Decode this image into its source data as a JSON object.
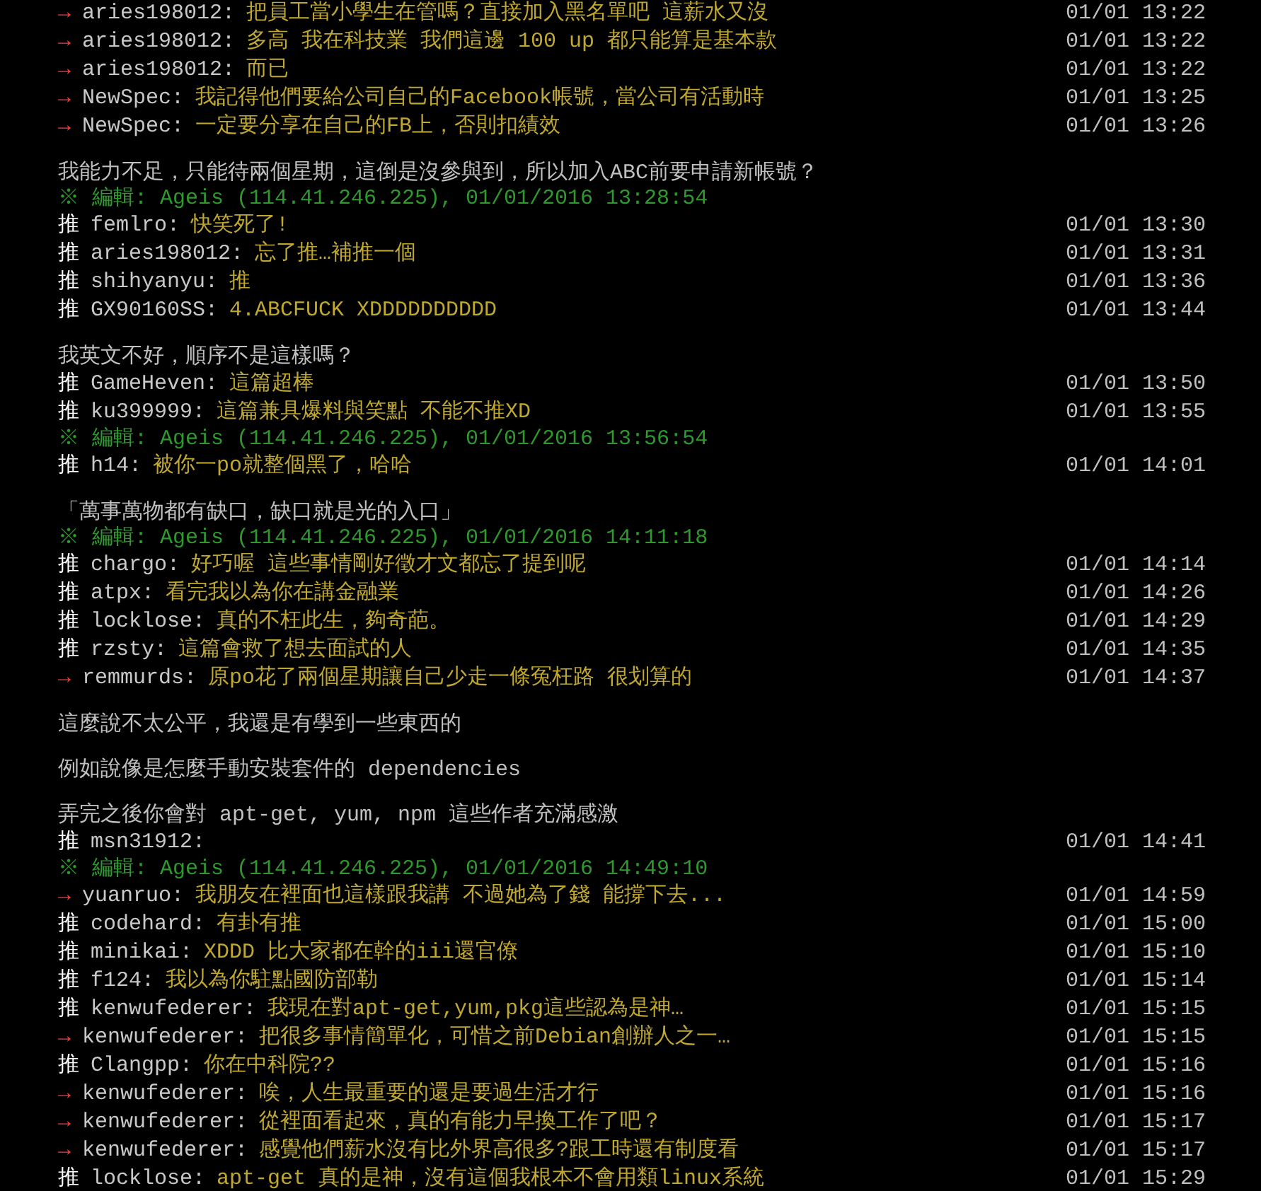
{
  "lines": [
    {
      "kind": "arrow",
      "tag": "→",
      "user": "aries198012:",
      "text": "把員工當小學生在管嗎？直接加入黑名單吧 這薪水又沒",
      "time": "01/01 13:22"
    },
    {
      "kind": "arrow",
      "tag": "→",
      "user": "aries198012:",
      "text": "多高 我在科技業 我們這邊 100 up 都只能算是基本款",
      "time": "01/01 13:22"
    },
    {
      "kind": "arrow",
      "tag": "→",
      "user": "aries198012:",
      "text": "而已",
      "time": "01/01 13:22"
    },
    {
      "kind": "arrow",
      "tag": "→",
      "user": "NewSpec:",
      "text": "我記得他們要給公司自己的Facebook帳號，當公司有活動時",
      "time": "01/01 13:25"
    },
    {
      "kind": "arrow",
      "tag": "→",
      "user": "NewSpec:",
      "text": "一定要分享在自己的FB上，否則扣績效",
      "time": "01/01 13:26"
    },
    {
      "kind": "article",
      "text": "我能力不足，只能待兩個星期，這倒是沒參與到，所以加入ABC前要申請新帳號？"
    },
    {
      "kind": "edit",
      "text": "※ 編輯: Ageis (114.41.246.225), 01/01/2016 13:28:54"
    },
    {
      "kind": "push",
      "tag": "推",
      "user": "femlro:",
      "text": "快笑死了!",
      "time": "01/01 13:30"
    },
    {
      "kind": "push",
      "tag": "推",
      "user": "aries198012:",
      "text": "忘了推…補推一個",
      "time": "01/01 13:31"
    },
    {
      "kind": "push",
      "tag": "推",
      "user": "shihyanyu:",
      "text": "推",
      "time": "01/01 13:36"
    },
    {
      "kind": "push",
      "tag": "推",
      "user": "GX90160SS:",
      "text": "4.ABCFUCK XDDDDDDDDDD",
      "time": "01/01 13:44"
    },
    {
      "kind": "article",
      "text": "我英文不好，順序不是這樣嗎？"
    },
    {
      "kind": "push",
      "tag": "推",
      "user": "GameHeven:",
      "text": "這篇超棒",
      "time": "01/01 13:50"
    },
    {
      "kind": "push",
      "tag": "推",
      "user": "ku399999:",
      "text": "這篇兼具爆料與笑點 不能不推XD",
      "time": "01/01 13:55"
    },
    {
      "kind": "edit",
      "text": "※ 編輯: Ageis (114.41.246.225), 01/01/2016 13:56:54"
    },
    {
      "kind": "push",
      "tag": "推",
      "user": "h14:",
      "text": "被你一po就整個黑了，哈哈",
      "time": "01/01 14:01"
    },
    {
      "kind": "article",
      "text": "「萬事萬物都有缺口，缺口就是光的入口」"
    },
    {
      "kind": "edit",
      "text": "※ 編輯: Ageis (114.41.246.225), 01/01/2016 14:11:18"
    },
    {
      "kind": "push",
      "tag": "推",
      "user": "chargo:",
      "text": "好巧喔 這些事情剛好徵才文都忘了提到呢",
      "time": "01/01 14:14"
    },
    {
      "kind": "push",
      "tag": "推",
      "user": "atpx:",
      "text": "看完我以為你在講金融業",
      "time": "01/01 14:26"
    },
    {
      "kind": "push",
      "tag": "推",
      "user": "locklose:",
      "text": "真的不枉此生，夠奇葩。",
      "time": "01/01 14:29"
    },
    {
      "kind": "push",
      "tag": "推",
      "user": "rzsty:",
      "text": "這篇會救了想去面試的人",
      "time": "01/01 14:35"
    },
    {
      "kind": "arrow",
      "tag": "→",
      "user": "remmurds:",
      "text": "原po花了兩個星期讓自己少走一條冤枉路 很划算的",
      "time": "01/01 14:37"
    },
    {
      "kind": "article",
      "text": "這麼說不太公平，我還是有學到一些東西的"
    },
    {
      "kind": "article",
      "text": "例如說像是怎麼手動安裝套件的 dependencies"
    },
    {
      "kind": "article",
      "text": "弄完之後你會對 apt-get, yum, npm 這些作者充滿感激"
    },
    {
      "kind": "push",
      "tag": "推",
      "user": "msn31912:",
      "time": "01/01 14:41"
    },
    {
      "kind": "edit",
      "text": "※ 編輯: Ageis (114.41.246.225), 01/01/2016 14:49:10"
    },
    {
      "kind": "arrow",
      "tag": "→",
      "user": "yuanruo:",
      "text": "我朋友在裡面也這樣跟我講 不過她為了錢 能撐下去...",
      "time": "01/01 14:59"
    },
    {
      "kind": "push",
      "tag": "推",
      "user": "codehard:",
      "text": "有卦有推",
      "time": "01/01 15:00"
    },
    {
      "kind": "push",
      "tag": "推",
      "user": "minikai:",
      "text": "XDDD 比大家都在幹的iii還官僚",
      "time": "01/01 15:10"
    },
    {
      "kind": "push",
      "tag": "推",
      "user": "f124:",
      "text": "我以為你駐點國防部勒",
      "time": "01/01 15:14"
    },
    {
      "kind": "push",
      "tag": "推",
      "user": "kenwufederer:",
      "text": "我現在對apt-get,yum,pkg這些認為是神…",
      "time": "01/01 15:15"
    },
    {
      "kind": "arrow",
      "tag": "→",
      "user": "kenwufederer:",
      "text": "把很多事情簡單化，可惜之前Debian創辦人之一…",
      "time": "01/01 15:15"
    },
    {
      "kind": "push",
      "tag": "推",
      "user": "Clangpp:",
      "text": "你在中科院??",
      "time": "01/01 15:16"
    },
    {
      "kind": "arrow",
      "tag": "→",
      "user": "kenwufederer:",
      "text": "唉，人生最重要的還是要過生活才行",
      "time": "01/01 15:16"
    },
    {
      "kind": "arrow",
      "tag": "→",
      "user": "kenwufederer:",
      "text": "從裡面看起來，真的有能力早換工作了吧？",
      "time": "01/01 15:17"
    },
    {
      "kind": "arrow",
      "tag": "→",
      "user": "kenwufederer:",
      "text": "感覺他們薪水沒有比外界高很多?跟工時還有制度看",
      "time": "01/01 15:17"
    },
    {
      "kind": "push",
      "tag": "推",
      "user": "locklose:",
      "text": "apt-get 真的是神，沒有這個我根本不會用類linux系統",
      "time": "01/01 15:29"
    }
  ]
}
